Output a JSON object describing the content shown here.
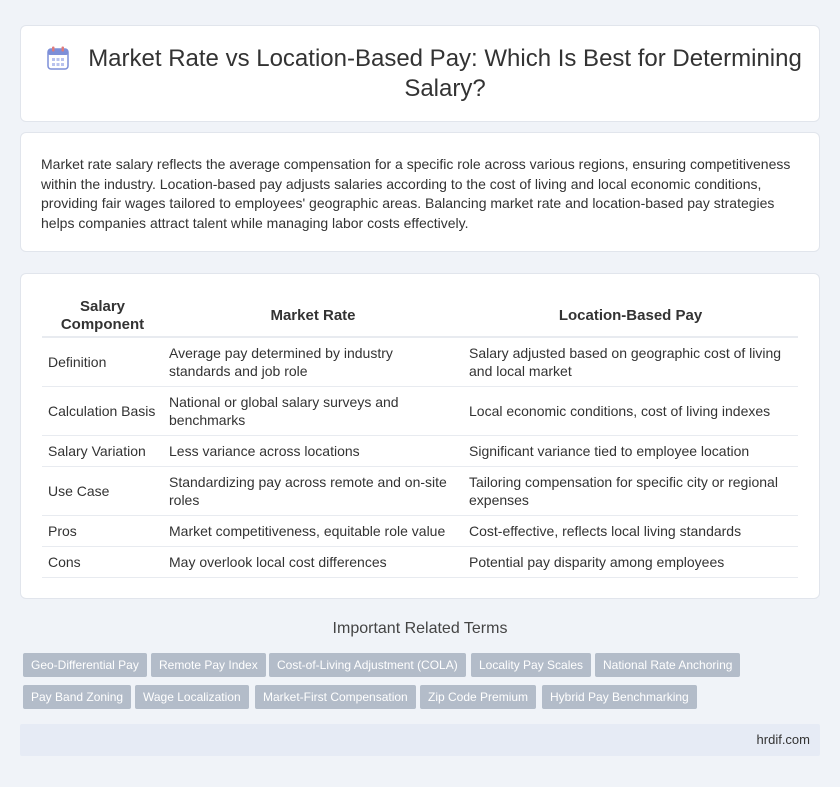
{
  "title": "Market Rate vs Location-Based Pay: Which Is Best for Determining Salary?",
  "intro": "Market rate salary reflects the average compensation for a specific role across various regions, ensuring competitiveness within the industry. Location-based pay adjusts salaries according to the cost of living and local economic conditions, providing fair wages tailored to employees' geographic areas. Balancing market rate and location-based pay strategies helps companies attract talent while managing labor costs effectively.",
  "table": {
    "headers": [
      "Salary Component",
      "Market Rate",
      "Location-Based Pay"
    ],
    "rows": [
      [
        "Definition",
        "Average pay determined by industry standards and job role",
        "Salary adjusted based on geographic cost of living and local market"
      ],
      [
        "Calculation Basis",
        "National or global salary surveys and benchmarks",
        "Local economic conditions, cost of living indexes"
      ],
      [
        "Salary Variation",
        "Less variance across locations",
        "Significant variance tied to employee location"
      ],
      [
        "Use Case",
        "Standardizing pay across remote and on-site roles",
        "Tailoring compensation for specific city or regional expenses"
      ],
      [
        "Pros",
        "Market competitiveness, equitable role value",
        "Cost-effective, reflects local living standards"
      ],
      [
        "Cons",
        "May overlook local cost differences",
        "Potential pay disparity among employees"
      ]
    ]
  },
  "related": {
    "title": "Important Related Terms",
    "tags": [
      "Geo-Differential Pay",
      "Remote Pay Index",
      "Cost-of-Living Adjustment (COLA)",
      "Locality Pay Scales",
      "National Rate Anchoring",
      "Pay Band Zoning",
      "Wage Localization",
      "Market-First Compensation",
      "Zip Code Premium",
      "Hybrid Pay Benchmarking"
    ]
  },
  "footer": "hrdif.com",
  "icon": "calendar-icon"
}
